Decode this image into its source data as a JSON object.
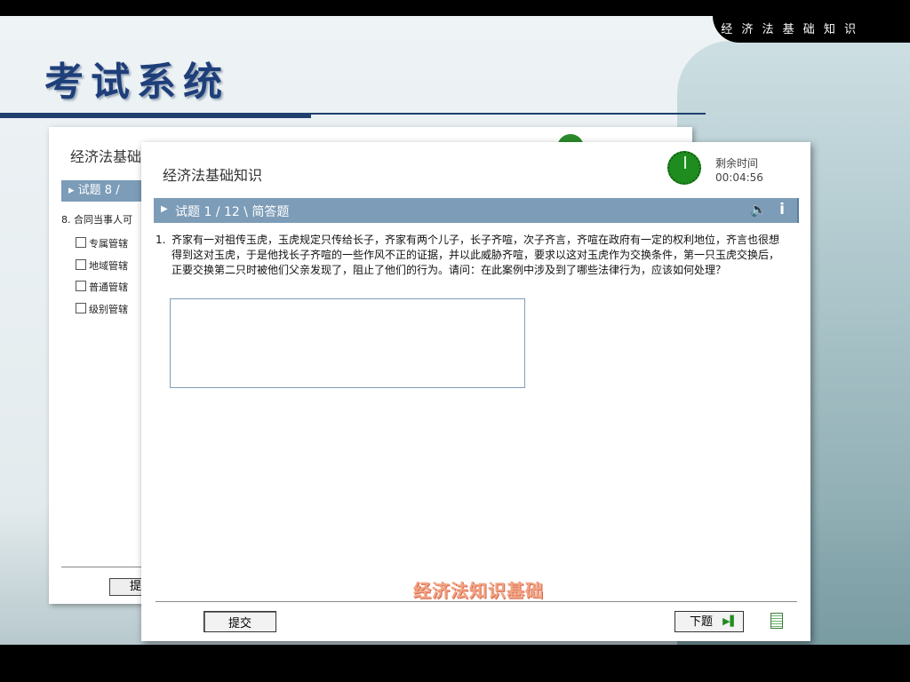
{
  "header": {
    "course_title": "经 济 法 基 础 知 识",
    "app_title": "考试系统"
  },
  "back_window": {
    "title": "经济法基础",
    "question_label": "试题 8 / ",
    "question_text": "8. 合同当事人可",
    "options": [
      "专属管辖",
      "地域管辖",
      "普通管辖",
      "级别管辖"
    ],
    "submit_label": "提"
  },
  "dialog": {
    "title": "经济法基础知识",
    "timer_label": "剩余时间",
    "timer_value": "00:04:56",
    "question_label": "试题 1 / 12 \\ 简答题",
    "question_number": "1.",
    "question_text": "齐家有一对祖传玉虎，玉虎规定只传给长子，齐家有两个儿子，长子齐喧，次子齐言，齐喧在政府有一定的权利地位，齐言也很想得到这对玉虎，于是他找长子齐喧的一些作风不正的证据，并以此威胁齐喧，要求以这对玉虎作为交换条件，第一只玉虎交换后，正要交换第二只时被他们父亲发现了，阻止了他们的行为。请问：在此案例中涉及到了哪些法律行为，应该如何处理？",
    "answer_value": "",
    "watermark": "经济法知识基础",
    "submit_label": "提交",
    "next_label": "下题"
  },
  "icons": {
    "audio": "speaker-icon",
    "info": "info-icon",
    "next": "play-icon",
    "notes": "notepad-icon",
    "timer": "clock-icon"
  },
  "colors": {
    "header_bar": "#7c9cb8",
    "title_blue": "#1e3f7a",
    "timer_green": "#1f8c1f",
    "watermark": "#f1a585"
  }
}
